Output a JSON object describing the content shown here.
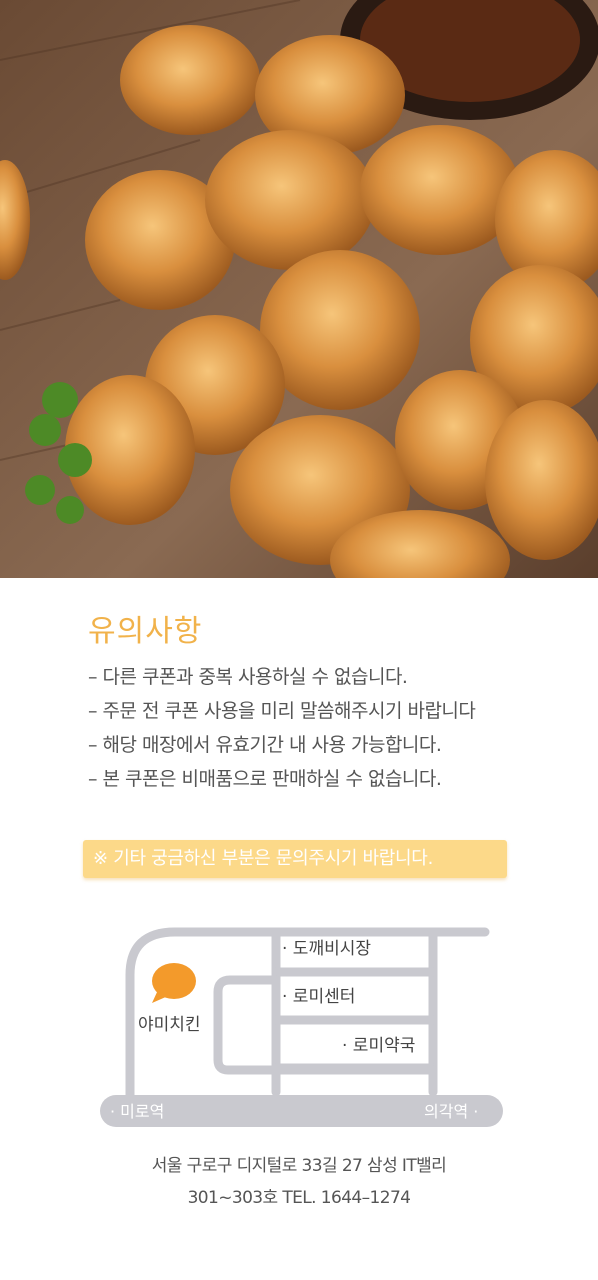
{
  "notice": {
    "title": "유의사항",
    "items": [
      "– 다른 쿠폰과 중복 사용하실 수 없습니다.",
      "– 주문 전 쿠폰 사용을 미리 말씀해주시기 바랍니다",
      "– 해당 매장에서 유효기간 내 사용 가능합니다.",
      "– 본 쿠폰은 비매품으로 판매하실 수 없습니다."
    ]
  },
  "banner": {
    "text": "※ 기타 궁금하신 부분은 문의주시기 바랍니다."
  },
  "map": {
    "store": "야미치킨",
    "places": [
      "· 도깨비시장",
      "· 로미센터",
      "· 로미약국"
    ],
    "station_left": "· 미로역",
    "station_right": "의각역 ·"
  },
  "address": {
    "line1": "서울 구로구 디지털로 33길 27 삼성 IT밸리",
    "line2": "301~303호 TEL. 1644–1274"
  },
  "colors": {
    "accent": "#f1b24a",
    "banner": "#fcd989",
    "map_road": "#c9c9cf",
    "pin": "#f39a2b"
  }
}
